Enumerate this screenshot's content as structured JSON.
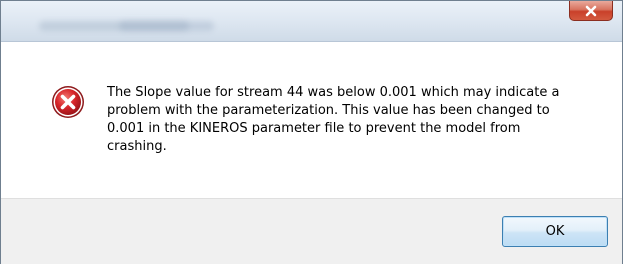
{
  "dialog": {
    "close_icon": "close-x-icon",
    "message_icon": "error-icon",
    "message_lines": [
      "The Slope value for stream 44 was below 0.001 which may indicate a",
      "problem with the parameterization.  This value has been changed to",
      "0.001 in the KINEROS parameter file to prevent the model from",
      "crashing."
    ],
    "ok_label": "OK"
  },
  "colors": {
    "error_red": "#d8262b",
    "close_red": "#c9402a",
    "button_border": "#3c7fb1",
    "footer_bg": "#f0f0f0"
  }
}
